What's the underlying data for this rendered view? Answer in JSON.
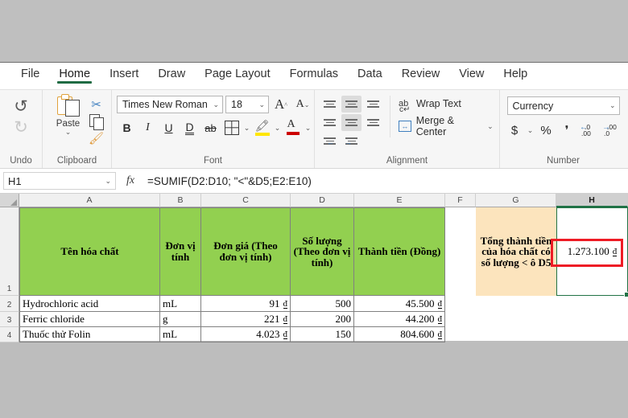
{
  "app": {
    "ribbon_tabs": [
      {
        "label": "File",
        "active": false
      },
      {
        "label": "Home",
        "active": true
      },
      {
        "label": "Insert",
        "active": false
      },
      {
        "label": "Draw",
        "active": false
      },
      {
        "label": "Page Layout",
        "active": false
      },
      {
        "label": "Formulas",
        "active": false
      },
      {
        "label": "Data",
        "active": false
      },
      {
        "label": "Review",
        "active": false
      },
      {
        "label": "View",
        "active": false
      },
      {
        "label": "Help",
        "active": false
      }
    ],
    "accent_color": "#217346"
  },
  "ribbon": {
    "undo": {
      "group_label": "Undo",
      "undo_glyph": "↺",
      "redo_glyph": "↻"
    },
    "clipboard": {
      "group_label": "Clipboard",
      "paste_label": "Paste",
      "caret": "⌄"
    },
    "font": {
      "group_label": "Font",
      "font_name": "Times New Roman",
      "font_size": "18",
      "caret": "⌄",
      "grow_label": "A",
      "shrink_label": "A",
      "bold_label": "B",
      "italic_label": "I",
      "underline_label": "U",
      "double_underline_label": "D",
      "strikethrough_label": "ab"
    },
    "alignment": {
      "group_label": "Alignment",
      "wrap_text_label": "Wrap Text",
      "merge_center_label": "Merge & Center",
      "merge_caret": "⌄",
      "wrap_icon_top": "ab",
      "wrap_icon_bottom": "c↵"
    },
    "number": {
      "group_label": "Number",
      "format": "Currency",
      "caret": "⌄",
      "currency_glyph": "$",
      "percent_glyph": "%",
      "comma_glyph": "❜",
      "inc_dec_top": ".0",
      "inc_dec_bottom": ".00",
      "dec_dec_top": ".00",
      "dec_dec_bottom": ".0"
    }
  },
  "formula_bar": {
    "name_box": "H1",
    "name_caret": "⌄",
    "fx_label": "fx",
    "formula": "=SUMIF(D2:D10; \"<\"&D5;E2:E10)"
  },
  "grid": {
    "column_headers": [
      {
        "label": "A",
        "selected": false
      },
      {
        "label": "B",
        "selected": false
      },
      {
        "label": "C",
        "selected": false
      },
      {
        "label": "D",
        "selected": false
      },
      {
        "label": "E",
        "selected": false
      },
      {
        "label": "F",
        "selected": false
      },
      {
        "label": "G",
        "selected": false
      },
      {
        "label": "H",
        "selected": true
      }
    ],
    "row_headers": [
      "1",
      "2",
      "3",
      "4"
    ],
    "header_row": {
      "a": "Tên hóa chất",
      "b": "Đơn vị tính",
      "c": "Đơn giá (Theo đơn vị tính)",
      "d": "Số lượng (Theo đơn vị tính)",
      "e": "Thành tiền (Đồng)",
      "f": "",
      "g": "Tổng thành tiền của hóa chất có số lượng < ô D5",
      "h_value": "1.273.100",
      "h_currency": "đ"
    },
    "rows": [
      {
        "row": "2",
        "name": "Hydrochloric acid",
        "unit": "mL",
        "price": "91",
        "price_currency": "đ",
        "quantity": "500",
        "total": "45.500",
        "total_currency": "đ"
      },
      {
        "row": "3",
        "name": "Ferric chloride",
        "unit": "g",
        "price": "221",
        "price_currency": "đ",
        "quantity": "200",
        "total": "44.200",
        "total_currency": "đ"
      },
      {
        "row": "4",
        "name": "Thuốc thử Folin",
        "unit": "mL",
        "price": "4.023",
        "price_currency": "đ",
        "quantity": "150",
        "total": "804.600",
        "total_currency": "đ"
      }
    ],
    "selected_cell": "H1",
    "header_fill_color": "#92D050",
    "accent_fill_color": "#FCE4BD",
    "annotation_color": "#EE1C25"
  }
}
